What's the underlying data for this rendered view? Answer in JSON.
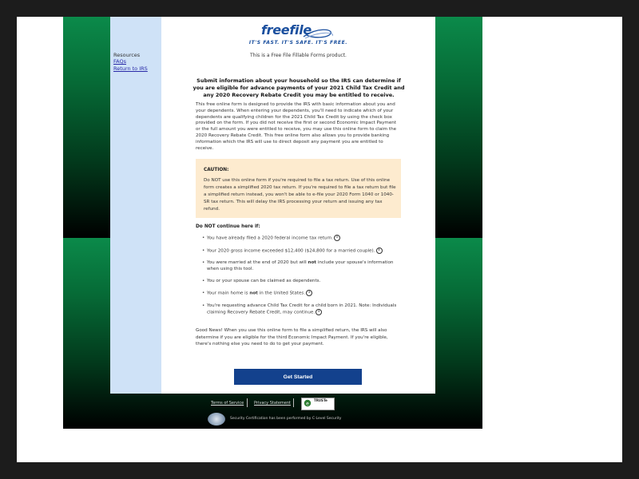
{
  "logo": {
    "text": "freefile",
    "tagline": "IT'S FAST. IT'S SAFE. IT'S FREE."
  },
  "product_line": "This is a Free File Fillable Forms product.",
  "sidebar": {
    "title": "Resources",
    "links": [
      "FAQs",
      "Return to IRS"
    ]
  },
  "heading": "Submit information about your household so the IRS can determine if you are eligible for advance payments of your 2021 Child Tax Credit and any 2020 Recovery Rebate Credit you may be entitled to receive.",
  "intro": "This free online form is designed to provide the IRS with basic information about you and your dependents. When entering your dependents, you'll need to indicate which of your dependents are qualifying children for the 2021 Child Tax Credit by using the check box provided on the form. If you did not receive the first or second Economic Impact Payment or the full amount you were entitled to receive, you may use this online form to claim the 2020 Recovery Rebate Credit. This free online form also allows you to provide banking information which the IRS will use to direct deposit any payment you are entitled to receive.",
  "caution": {
    "title": "CAUTION:",
    "body": "Do NOT use this online form if you're required to file a tax return. Use of this online form creates a simplified 2020 tax return. If you're required to file a tax return but file a simplified return instead, you won't be able to e-file your 2020 Form 1040 or 1040-SR tax return. This will delay the IRS processing your return and issuing any tax refund."
  },
  "do_not_continue": "Do NOT continue here if:",
  "bullets": [
    {
      "pre": "You have already filed a 2020 federal income tax return.",
      "bold": "",
      "post": "",
      "info": true
    },
    {
      "pre": "Your 2020 gross income exceeded $12,400 ($24,800 for a married couple).",
      "bold": "",
      "post": "",
      "info": true
    },
    {
      "pre": "You were married at the end of 2020 but will ",
      "bold": "not",
      "post": " include your spouse's information when using this tool.",
      "info": false
    },
    {
      "pre": "You or your spouse can be claimed as dependents.",
      "bold": "",
      "post": "",
      "info": false
    },
    {
      "pre": "Your main home is ",
      "bold": "not",
      "post": " in the United States.",
      "info": true
    },
    {
      "pre": "You're requesting advance Child Tax Credit for a child born in 2021. Note: Individuals claiming Recovery Rebate Credit, may continue.",
      "bold": "",
      "post": "",
      "info": true
    }
  ],
  "info_glyph": "i",
  "good_news": "Good News! When you use this online form to file a simplified return, the IRS will also determine if you are eligible for the third Economic Impact Payment. If you're eligible, there's nothing else you need to do to get your payment.",
  "button": "Get Started",
  "footer": {
    "terms": "Terms of Service",
    "privacy": "Privacy Statement",
    "trust": "TRUSTe",
    "certification": "Security Certification has been performed by C-Level Security"
  },
  "colors": {
    "brand_blue": "#13418d",
    "caution_bg": "#fdebcf",
    "sidebar_bg": "#cfe2f7",
    "green": "#0b8a4a"
  }
}
